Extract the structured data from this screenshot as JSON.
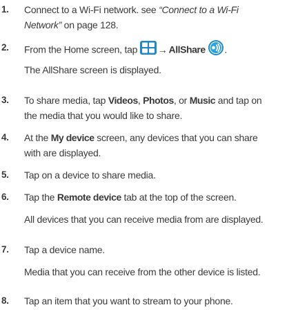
{
  "steps": [
    {
      "num": "1.",
      "line1": "Connect to a Wi-Fi network. see ",
      "ref_a": "“Connect to a Wi-Fi",
      "ref_b": "Network”",
      "line2_tail": " on page 128."
    },
    {
      "num": "2.",
      "pre": "From the Home screen, tap ",
      "arrow": "→",
      "app": "AllShare",
      "post": ".",
      "sub": "The AllShare screen is displayed."
    },
    {
      "num": "3.",
      "pre": "To share media, tap ",
      "videos": "Videos",
      "sep1": ", ",
      "photos": "Photos",
      "sep2": ", or ",
      "music": "Music",
      "post": " and tap on",
      "line2": "the media that you would like to share."
    },
    {
      "num": "4.",
      "pre": "At the ",
      "bold": "My device",
      "post": " screen, any devices that you can share",
      "line2": "with are displayed."
    },
    {
      "num": "5.",
      "text": "Tap on a device to share media."
    },
    {
      "num": "6.",
      "pre": "Tap the ",
      "bold": "Remote device",
      "post": " tab at the top of the screen.",
      "sub": "All devices that you can receive media from are displayed."
    },
    {
      "num": "7.",
      "text": "Tap a device name.",
      "sub": "Media that you can receive from the other device is listed."
    },
    {
      "num": "8.",
      "text": "Tap an item that you want to stream to your phone."
    }
  ],
  "icons": {
    "apps": "apps-grid-icon",
    "allshare": "allshare-icon"
  },
  "colors": {
    "apps_icon": "#1e88c8",
    "allshare_icon": "#1e88c8",
    "text": "#3a3a3a"
  }
}
